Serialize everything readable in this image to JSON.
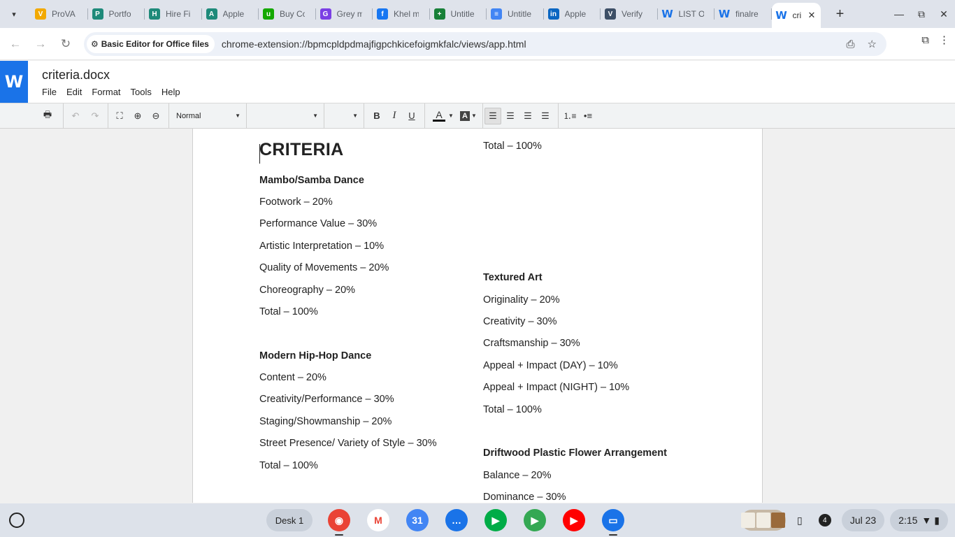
{
  "browser": {
    "tabs": [
      {
        "label": "ProVA",
        "icon": "prova-icon",
        "color": "#f2a900",
        "glyph": "V"
      },
      {
        "label": "Portfo",
        "icon": "portfolio-icon",
        "color": "#1e8a7a",
        "glyph": "P"
      },
      {
        "label": "Hire Fi",
        "icon": "hire-icon",
        "color": "#1e8a7a",
        "glyph": "H"
      },
      {
        "label": "Apple",
        "icon": "apple-icon",
        "color": "#1e8a7a",
        "glyph": "A"
      },
      {
        "label": "Buy Co",
        "icon": "upwork-icon",
        "color": "#14a800",
        "glyph": "u"
      },
      {
        "label": "Grey m",
        "icon": "grey-icon",
        "color": "#7b3fe4",
        "glyph": "G"
      },
      {
        "label": "Khel m",
        "icon": "facebook-icon",
        "color": "#1877f2",
        "glyph": "f"
      },
      {
        "label": "Untitle",
        "icon": "sheets-icon",
        "color": "#188038",
        "glyph": "+"
      },
      {
        "label": "Untitle",
        "icon": "docs-icon",
        "color": "#4285f4",
        "glyph": "≡"
      },
      {
        "label": "Apple",
        "icon": "linkedin-icon",
        "color": "#0a66c2",
        "glyph": "in"
      },
      {
        "label": "Verify",
        "icon": "verify-icon",
        "color": "#3d4f66",
        "glyph": "V"
      },
      {
        "label": "LIST O",
        "icon": "word-icon",
        "color": "#ffffff",
        "glyph": "W"
      },
      {
        "label": "finalre",
        "icon": "word-icon",
        "color": "#ffffff",
        "glyph": "W"
      }
    ],
    "active_tab": {
      "label": "cri",
      "icon": "word-icon",
      "glyph": "W"
    },
    "new_tab": "+",
    "omnibox": {
      "chip": "Basic Editor for Office files",
      "url": "chrome-extension://bpmcpldpdmajfigpchkicefoigmkfalc/views/app.html"
    }
  },
  "app": {
    "logo": "W",
    "doc_name": "criteria.docx",
    "menu": [
      "File",
      "Edit",
      "Format",
      "Tools",
      "Help"
    ],
    "toolbar": {
      "style": "Normal",
      "font": "",
      "size": "",
      "bold": "B",
      "italic": "I",
      "underline": "U",
      "font_color": "A",
      "highlight": "A"
    }
  },
  "document": {
    "title": "CRITERIA",
    "left": [
      {
        "text": "Mambo/Samba Dance",
        "bold": true
      },
      {
        "text": "Footwork – 20%"
      },
      {
        "text": "Performance Value – 30%"
      },
      {
        "text": "Artistic Interpretation – 10%"
      },
      {
        "text": "Quality of Movements – 20%"
      },
      {
        "text": "Choreography – 20%"
      },
      {
        "text": "Total – 100%"
      },
      {
        "text": "Modern Hip-Hop Dance",
        "bold": true
      },
      {
        "text": "Content – 20%"
      },
      {
        "text": "Creativity/Performance – 30%"
      },
      {
        "text": "Staging/Showmanship – 20%"
      },
      {
        "text": "Street Presence/ Variety of Style – 30%"
      },
      {
        "text": "Total – 100%"
      }
    ],
    "right": [
      {
        "text": "Total – 100%"
      },
      {
        "text": "Textured Art",
        "bold": true
      },
      {
        "text": "Originality – 20%"
      },
      {
        "text": "Creativity – 30%"
      },
      {
        "text": "Craftsmanship – 30%"
      },
      {
        "text": "Appeal + Impact (DAY) – 10%"
      },
      {
        "text": "Appeal + Impact (NIGHT) – 10%"
      },
      {
        "text": "Total – 100%"
      },
      {
        "text": "Driftwood Plastic Flower Arrangement",
        "bold": true
      },
      {
        "text": "Balance – 20%"
      },
      {
        "text": "Dominance – 30%"
      }
    ]
  },
  "shelf": {
    "desk": "Desk 1",
    "apps": [
      {
        "name": "chrome-icon",
        "color": "#ea4335",
        "glyph": "◉"
      },
      {
        "name": "gmail-icon",
        "color": "#ffffff",
        "glyph": "M"
      },
      {
        "name": "calendar-icon",
        "color": "#4285f4",
        "glyph": "31"
      },
      {
        "name": "chat-icon",
        "color": "#1a73e8",
        "glyph": "…"
      },
      {
        "name": "meet-icon",
        "color": "#00ac47",
        "glyph": "▶"
      },
      {
        "name": "play-store-icon",
        "color": "#34a853",
        "glyph": "▶"
      },
      {
        "name": "youtube-icon",
        "color": "#ff0000",
        "glyph": "▶"
      },
      {
        "name": "files-icon",
        "color": "#1a73e8",
        "glyph": "▭"
      }
    ],
    "notifications": "4",
    "date": "Jul 23",
    "time": "2:15"
  }
}
